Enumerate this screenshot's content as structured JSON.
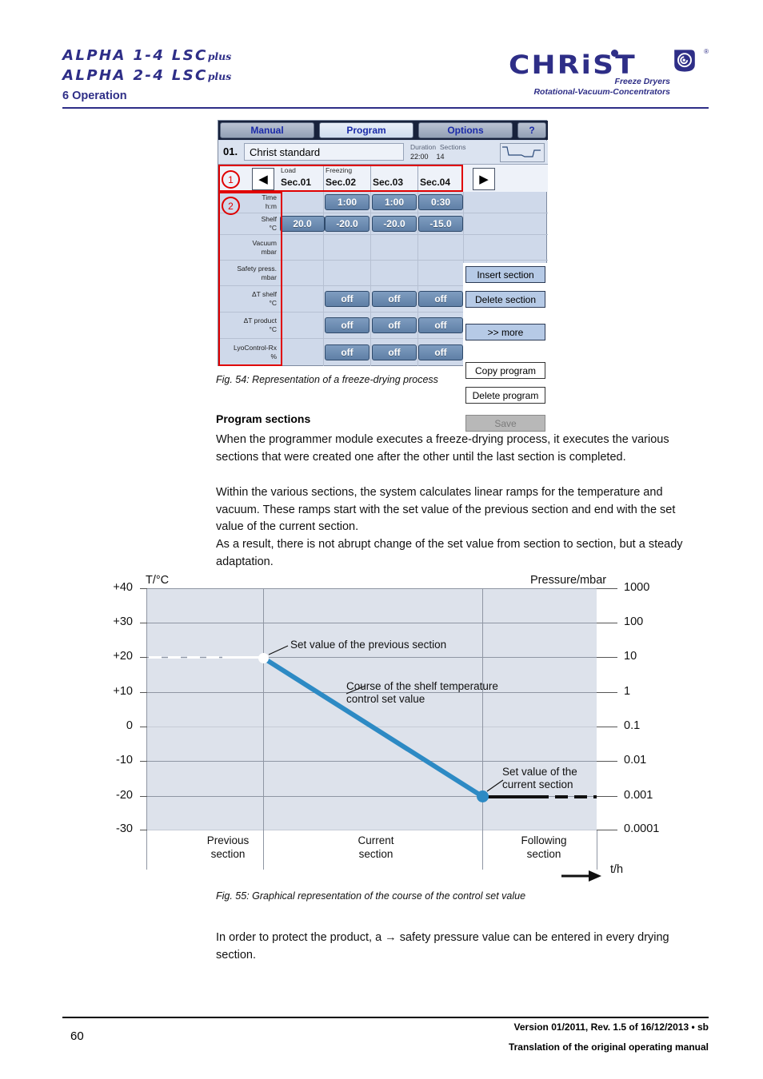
{
  "header": {
    "model_line1": "ALPHA 1-4 LSC",
    "model_line1_sup": "plus",
    "model_line2": "ALPHA 2-4 LSC",
    "model_line2_sup": "plus",
    "chapter": "6 Operation",
    "brand": "CHRiST",
    "brand_tagline1": "Freeze Dryers",
    "brand_tagline2": "Rotational-Vacuum-Concentrators",
    "registered": "®",
    "brand_color": "#2e2e87"
  },
  "device_ui": {
    "tabs": [
      {
        "label": "Manual",
        "selected": false
      },
      {
        "label": "Program",
        "selected": true
      },
      {
        "label": "Options",
        "selected": false
      },
      {
        "label": "?",
        "selected": false
      }
    ],
    "program": {
      "number": "01.",
      "name": "Christ standard",
      "duration_label": "Duration",
      "sections_label": "Sections",
      "duration_value": "22:00",
      "sections_value": "14"
    },
    "section_bar": {
      "group_load": "Load",
      "group_freezing": "Freezing",
      "sections": [
        "Sec.01",
        "Sec.02",
        "Sec.03",
        "Sec.04"
      ],
      "prev_arrow": "◀",
      "next_arrow": "▶"
    },
    "rows": [
      {
        "label1": "Time",
        "label2": "h:m",
        "values": [
          "",
          "1:00",
          "1:00",
          "0:30"
        ]
      },
      {
        "label1": "Shelf",
        "label2": "°C",
        "values": [
          "20.0",
          "-20.0",
          "-20.0",
          "-15.0"
        ]
      },
      {
        "label1": "Vacuum",
        "label2": "mbar",
        "values": [
          "",
          "",
          "",
          ""
        ]
      },
      {
        "label1": "Safety press.",
        "label2": "mbar",
        "values": [
          "",
          "",
          "",
          ""
        ]
      },
      {
        "label1": "ΔT shelf",
        "label2": "°C",
        "values": [
          "",
          "off",
          "off",
          "off"
        ]
      },
      {
        "label1": "ΔT product",
        "label2": "°C",
        "values": [
          "",
          "off",
          "off",
          "off"
        ]
      },
      {
        "label1": "LyoControl-Rx",
        "label2": "%",
        "values": [
          "",
          "off",
          "off",
          "off"
        ]
      }
    ],
    "buttons": [
      {
        "label": "Insert section",
        "style": "blue"
      },
      {
        "label": "Delete section",
        "style": "blue"
      },
      {
        "label": ">> more",
        "style": "blue"
      },
      {
        "label": "Copy program",
        "style": "white"
      },
      {
        "label": "Delete program",
        "style": "white"
      },
      {
        "label": "Save",
        "style": "gray"
      }
    ],
    "callouts": [
      "1",
      "2"
    ],
    "callout_color": "#e00000"
  },
  "fig54_caption": "Fig. 54: Representation of a freeze-drying process",
  "section_heading": "Program sections",
  "paragraphs": [
    "When the programmer module executes a freeze-drying process, it executes the various sections that were created one after the other until the last section is completed.",
    "Within the various sections, the system calculates linear ramps for the temperature and vacuum. These ramps start with the set value of the previous section and end with the set value of the current section.",
    "As a result, there is not abrupt change of the set value from section to section, but a steady adaptation."
  ],
  "fig55_caption": "Fig. 55: Graphical representation of the course of the control set value",
  "closing_paragraph": "In order to protect the product, a → safety pressure value can be entered in every drying section.",
  "chart_data": {
    "type": "line",
    "title": "",
    "ylabel_left": "T/°C",
    "ylabel_right": "Pressure/mbar",
    "xlabel": "t/h",
    "y_left_ticks": [
      "+40",
      "+30",
      "+20",
      "+10",
      "0",
      "-10",
      "-20",
      "-30"
    ],
    "y_left_values": [
      40,
      30,
      20,
      10,
      0,
      -10,
      -20,
      -30
    ],
    "y_right_ticks": [
      "1000",
      "100",
      "10",
      "1",
      "0.1",
      "0.01",
      "0.001",
      "0.0001"
    ],
    "y_right_values": [
      1000,
      100,
      10,
      1,
      0.1,
      0.01,
      0.001,
      0.0001
    ],
    "ylim_left": [
      -30,
      40
    ],
    "grid": true,
    "legend": "none",
    "x_sections": [
      "Previous\nsection",
      "Current\nsection",
      "Following\nsection"
    ],
    "x_section_labels": [
      "Previous",
      "section",
      "Current",
      "section",
      "Following",
      "section"
    ],
    "series": [
      {
        "name": "Set value of the previous section",
        "style": "dashed-white",
        "points": [
          {
            "x": 0.0,
            "y": 20
          },
          {
            "x": 0.26,
            "y": 20
          }
        ]
      },
      {
        "name": "Course of the shelf temperature control set value",
        "style": "solid-blue",
        "color": "#2d8ac4",
        "points": [
          {
            "x": 0.26,
            "y": 20
          },
          {
            "x": 0.745,
            "y": -21
          }
        ]
      },
      {
        "name": "Set value of the current section",
        "style": "dashed-black",
        "points": [
          {
            "x": 0.745,
            "y": -21
          },
          {
            "x": 1.0,
            "y": -21
          }
        ]
      }
    ],
    "markers": [
      {
        "label": "Set value of the previous section",
        "x": 0.26,
        "y": 20,
        "fill": "#ffffff"
      },
      {
        "label": "Set value of the current section",
        "x": 0.745,
        "y": -21,
        "fill": "#2d8ac4"
      }
    ],
    "annotations": [
      "Set value of the previous section",
      "Course of the shelf temperature",
      "control set value",
      "Set value of the",
      "current section"
    ]
  },
  "footer": {
    "page_number": "60",
    "version": "Version 01/2011, Rev. 1.5 of 16/12/2013 • sb",
    "translation": "Translation of the original operating manual"
  }
}
